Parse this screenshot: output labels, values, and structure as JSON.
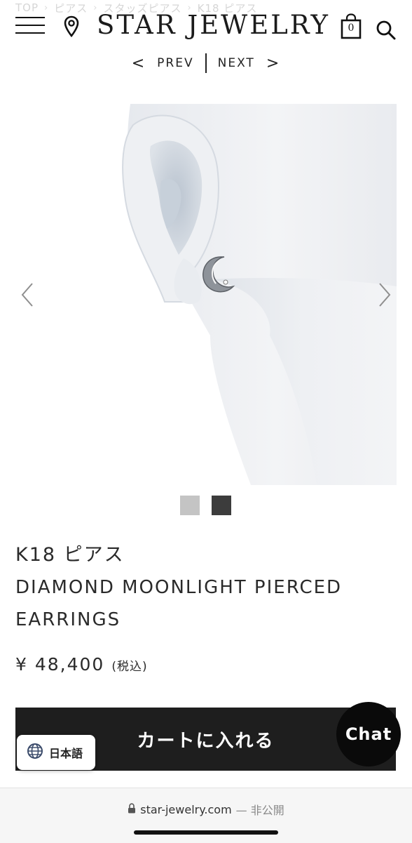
{
  "breadcrumb": {
    "items": [
      "TOP",
      "ピアス",
      "スタッズピアス",
      "K18 ピアス"
    ],
    "separator": "›"
  },
  "header": {
    "logo": "STAR JEWELRY",
    "cart_count": "0",
    "icons": [
      "hamburger-menu-icon",
      "location-pin-icon",
      "shopping-bag-icon",
      "search-icon"
    ]
  },
  "nav": {
    "prev_arrow": "<",
    "prev_label": "PREV",
    "next_label": "NEXT",
    "next_arrow": ">"
  },
  "gallery": {
    "thumbnails": [
      {
        "color": "#c4c4c4",
        "selected": false
      },
      {
        "color": "#3c3c3c",
        "selected": true
      }
    ]
  },
  "product": {
    "category": "K18 ピアス",
    "name": "DIAMOND MOONLIGHT PIERCED EARRINGS",
    "price": "¥ 48,400",
    "tax_note": "(税込)"
  },
  "actions": {
    "add_to_cart": "カートに入れる",
    "language": "日本語",
    "chat": "Chat"
  },
  "browser": {
    "url": "star-jewelry.com",
    "status": "— 非公開"
  },
  "colors": {
    "button_bg": "#1e1e1e",
    "chat_bg": "#0a0a0a",
    "text": "#2a2a2a"
  }
}
